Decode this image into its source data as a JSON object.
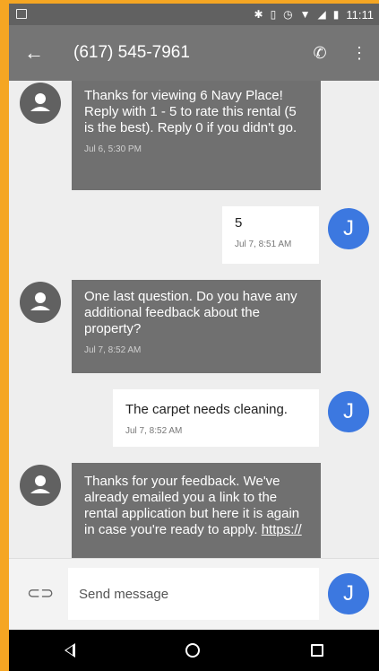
{
  "status": {
    "time": "11:11",
    "icons": [
      "bluetooth-icon",
      "vibrate-icon",
      "alarm-icon",
      "wifi-icon",
      "signal-icon",
      "battery-icon"
    ]
  },
  "header": {
    "title": "(617) 545-7961"
  },
  "messages": [
    {
      "text": "Thanks for viewing 6 Navy Place! Reply with 1 - 5 to rate this rental (5 is the best). Reply 0 if you didn't go.",
      "time": "Jul 6, 5:30 PM",
      "dir": "in"
    },
    {
      "text": "5",
      "time": "Jul 7, 8:51 AM",
      "dir": "out",
      "avatar": "J"
    },
    {
      "text": "One last question. Do you have any additional feedback about the property?",
      "time": "Jul 7, 8:52 AM",
      "dir": "in"
    },
    {
      "text": "The carpet needs cleaning.",
      "time": "Jul 7, 8:52 AM",
      "dir": "out",
      "avatar": "J"
    },
    {
      "text": "Thanks for your feedback. We've already emailed you a link to the rental application but here it is again in case you're ready to apply.",
      "link": "https://",
      "dir": "in"
    }
  ],
  "composer": {
    "placeholder": "Send message",
    "avatar": "J"
  },
  "colors": {
    "accent": "#3c78e0",
    "appbar": "#757575",
    "statusbar": "#616161",
    "incoming": "#707070",
    "frame": "#f5a623"
  }
}
